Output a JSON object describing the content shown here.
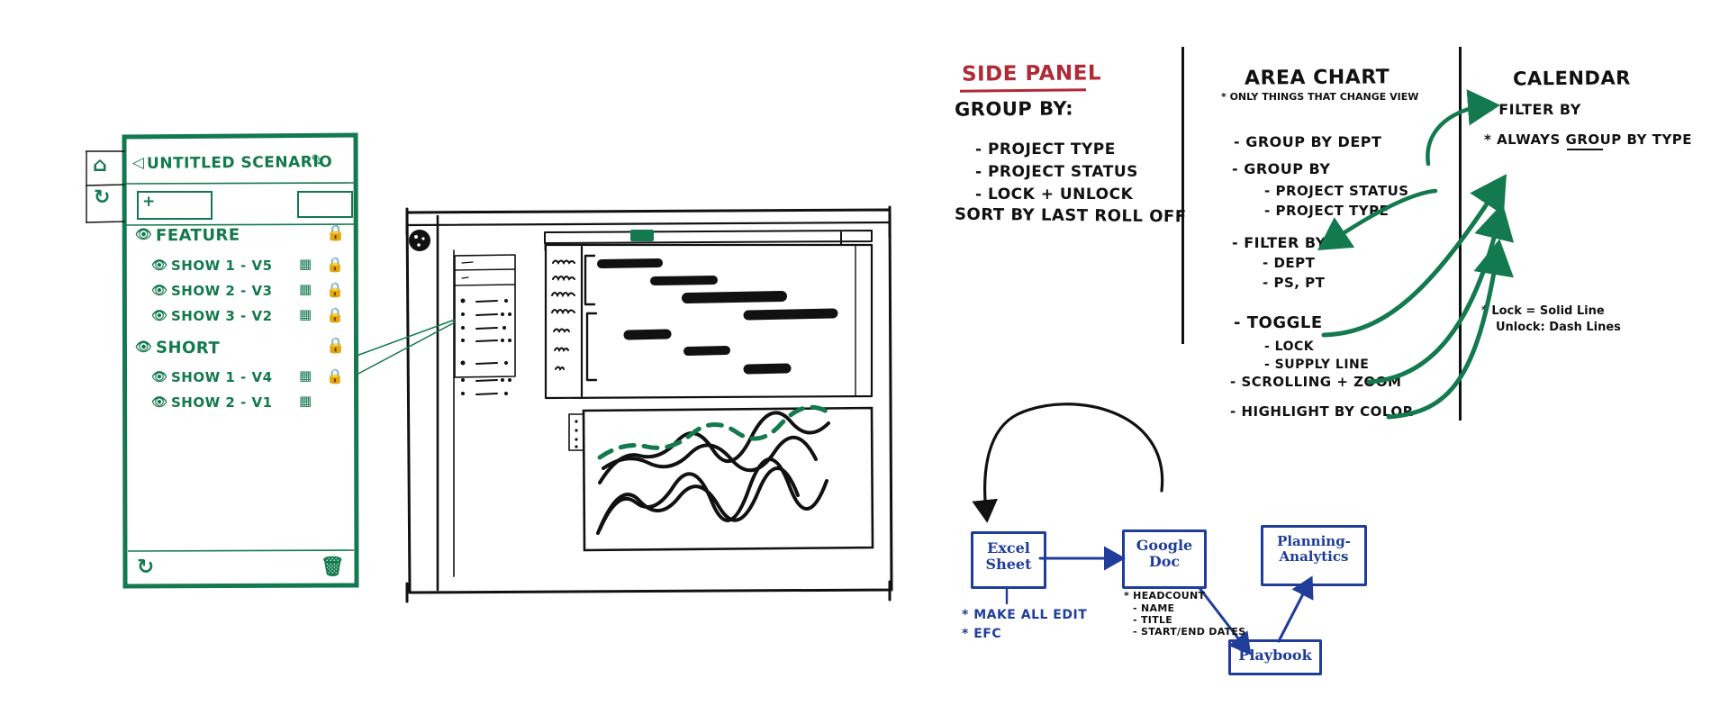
{
  "meta": {
    "kind": "hand-drawn whiteboard wireframe sketch",
    "ink_black": "#111111",
    "ink_green": "#13794e",
    "ink_red": "#b02a37",
    "ink_blue": "#1f3d99",
    "background": "#ffffff"
  },
  "scenario_panel": {
    "title": "UNTITLED SCENARIO",
    "back_icon": "back-chevron-icon",
    "edit_icon": "pencil-icon",
    "home_icon": "home-icon",
    "refresh_icon": "refresh-icon",
    "add_button_label": "+",
    "footer": {
      "refresh_icon": "refresh-icon",
      "trash_icon": "trash-icon"
    },
    "groups": [
      {
        "name": "FEATURE",
        "eye_icon": "eye-icon",
        "lock_icon": "lock-icon",
        "rows": [
          {
            "label": "SHOW 1 - v5",
            "eye_icon": "eye-icon",
            "grid_icon": "table-icon",
            "lock_icon": "lock-icon"
          },
          {
            "label": "SHOW 2 - v3",
            "eye_icon": "eye-icon",
            "grid_icon": "table-icon",
            "lock_icon": "lock-icon"
          },
          {
            "label": "SHOW 3 - v2",
            "eye_icon": "eye-icon",
            "grid_icon": "table-icon",
            "lock_icon": "lock-icon"
          }
        ]
      },
      {
        "name": "SHORT",
        "eye_icon": "eye-icon",
        "lock_icon": "lock-icon",
        "rows": [
          {
            "label": "SHOW 1 - v4",
            "eye_icon": "eye-icon",
            "grid_icon": "table-icon",
            "lock_icon": "lock-icon"
          },
          {
            "label": "SHOW 2 - v1",
            "eye_icon": "eye-icon",
            "grid_icon": "table-icon",
            "lock_icon": ""
          }
        ]
      }
    ]
  },
  "dashboard_mock": {
    "avatar_icon": "avatar-icon",
    "gantt_marker": "today-marker",
    "left_rail_label": "",
    "line_chart_note": "dashed green line over four solid black trend lines"
  },
  "notes": {
    "side_panel": {
      "heading": "Side Panel",
      "subheading": "Group By:",
      "items": [
        "- PROJECT TYPE",
        "- PROJECT STATUS",
        "- LOCK + UNLOCK"
      ],
      "footer_line": "Sort By Last Roll Off"
    },
    "area_chart": {
      "heading": "Area Chart",
      "starred_note": "* ONLY THINGS THAT CHANGE VIEW",
      "items": [
        "- Group By Dept",
        "- Group By",
        "- Project Status",
        "- Project Type",
        "- Filter By",
        "- Dept",
        "- PS, PT",
        "- Toggle",
        "- Lock",
        "- Supply Line",
        "- Scrolling + Zoom",
        "- Highlight By Color"
      ],
      "lines": [
        {
          "text": "- Group By Dept",
          "indent": 0
        },
        {
          "text": "- Group By",
          "indent": 0
        },
        {
          "text": "- Project Status",
          "indent": 1
        },
        {
          "text": "- Project Type",
          "indent": 1
        },
        {
          "text": "- Filter By",
          "indent": 0
        },
        {
          "text": "- Dept",
          "indent": 1
        },
        {
          "text": "- PS, PT",
          "indent": 1
        },
        {
          "text": "- Toggle",
          "indent": 0
        },
        {
          "text": "- Lock",
          "indent": 1
        },
        {
          "text": "- Supply Line",
          "indent": 1
        },
        {
          "text": "- Scrolling + Zoom",
          "indent": 0
        },
        {
          "text": "- Highlight By Color",
          "indent": 0
        }
      ]
    },
    "calendar": {
      "heading": "Calendar",
      "items": [
        "- Filter By",
        "* Always Group By Type"
      ],
      "filter_by": "- Filter By",
      "always_group": "* Always Group By Type",
      "underlined_word": "Group",
      "lock_note_line1": "* Lock = Solid Line",
      "lock_note_line2": "Unlock: Dash Lines"
    }
  },
  "flow": {
    "nodes": [
      {
        "id": "excel",
        "line1": "Excel",
        "line2": "Sheet"
      },
      {
        "id": "gdoc",
        "line1": "Google",
        "line2": "Doc"
      },
      {
        "id": "planning",
        "line1": "Planning-",
        "line2": "Analytics"
      },
      {
        "id": "playbook",
        "line1": "Playbook",
        "line2": ""
      }
    ],
    "excel_notes": [
      "* MAKE ALL EDIT",
      "* EFC"
    ],
    "gdoc_notes": [
      "* HEADCOUNT",
      "- NAME",
      "- TITLE",
      "- START/END DATES"
    ]
  }
}
